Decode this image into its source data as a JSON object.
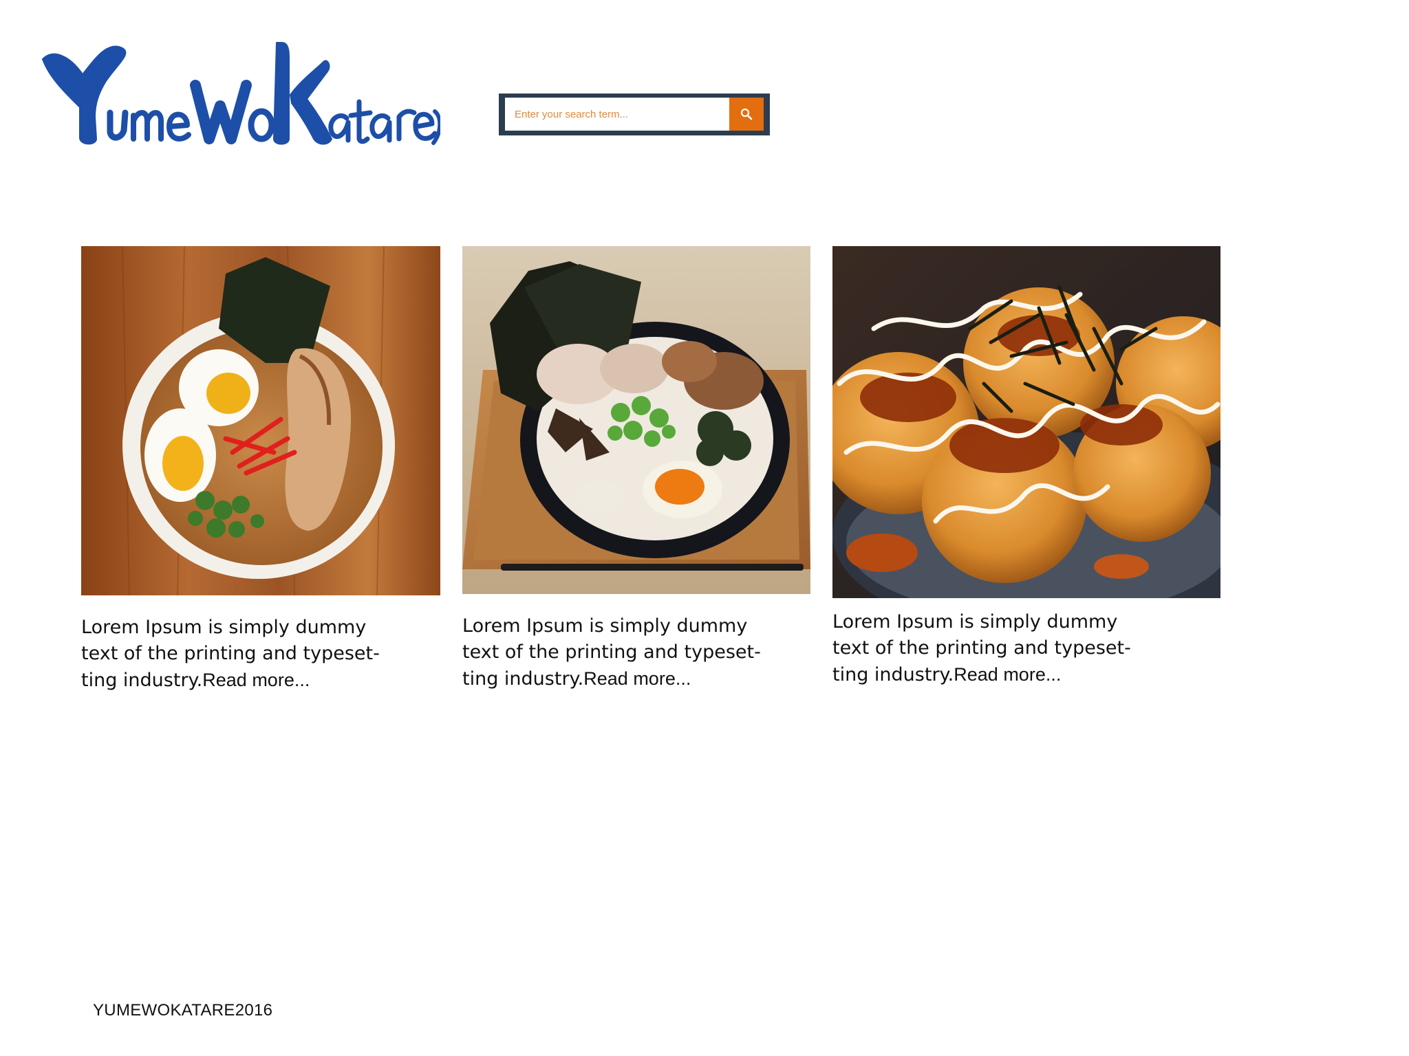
{
  "header": {
    "logo_text": "YumeWoKatare",
    "logo_color": "#1d4fa8",
    "search": {
      "placeholder": "Enter your search term...",
      "button_icon": "search-icon",
      "frame_color": "#2d3d4f",
      "button_color": "#e36e10"
    }
  },
  "cards": [
    {
      "image": "ramen-bowl-with-eggs-photo",
      "text": "Lorem Ipsum is simply dummy text of the printing and typeset-ting industry.",
      "read_more": "Read more..."
    },
    {
      "image": "tonkotsu-ramen-on-tray-photo",
      "text": "Lorem Ipsum is simply dummy text of the printing and typeset-ting industry.",
      "read_more": "Read more..."
    },
    {
      "image": "takoyaki-photo",
      "text": "Lorem Ipsum is simply dummy text of the printing and typeset-ting industry.",
      "read_more": "Read more..."
    }
  ],
  "footer": {
    "text": "YUMEWOKATARE2016"
  }
}
